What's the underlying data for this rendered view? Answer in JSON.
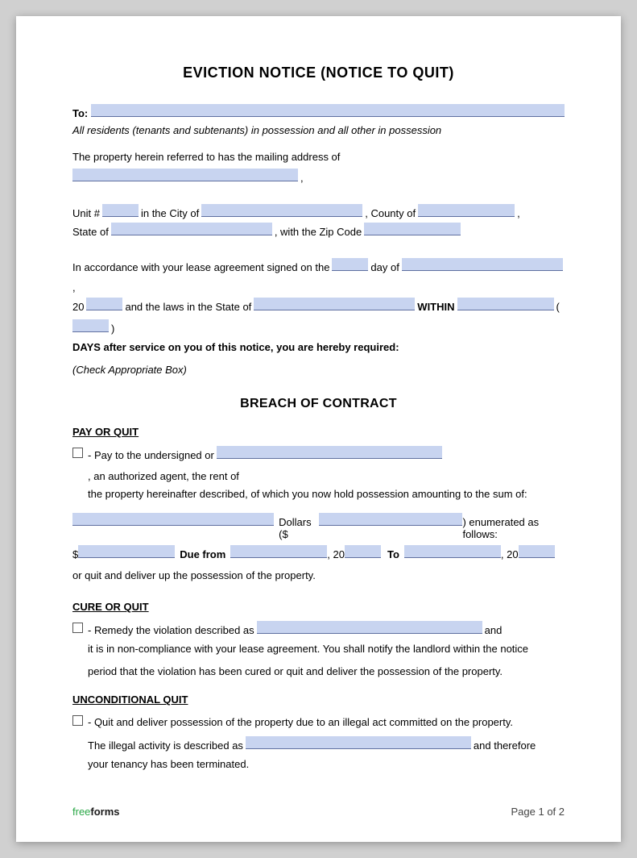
{
  "document": {
    "title": "EVICTION NOTICE (NOTICE TO QUIT)",
    "to_label": "To:",
    "italic_line": "All residents (tenants and subtenants) in possession and all other in possession",
    "address_intro": "The property herein referred to has the mailing address of",
    "unit_label": "Unit #",
    "city_label": "in the City of",
    "county_label": ", County of",
    "state_label": "State of",
    "zip_label": ", with the Zip Code",
    "lease_intro": "In accordance with your lease agreement signed on the",
    "day_label": "day of",
    "twenty_label": "20",
    "laws_label": "and the laws in the State of",
    "within_label": "WITHIN",
    "paren_open": "(",
    "paren_close": ")",
    "days_text": "DAYS after service on you of this notice, you are hereby required:",
    "check_label": "(Check Appropriate Box)",
    "breach_title": "BREACH OF CONTRACT",
    "pay_or_quit_title": "PAY OR QUIT",
    "pay_or_quit_text1": "- Pay to the undersigned or",
    "pay_or_quit_text2": ", an authorized agent, the rent of",
    "pay_or_quit_text3": "the property hereinafter described, of which you now hold possession amounting to the sum of:",
    "dollars_label": "Dollars ($",
    "dollars_close": ") enumerated as follows:",
    "due_dollar": "$",
    "due_from_label": "Due from",
    "due_twenty1": ", 20",
    "to_label2": "To",
    "due_twenty2": ", 20",
    "quit_deliver": "or quit and deliver up the possession of the property.",
    "cure_or_quit_title": "CURE OR QUIT",
    "cure_text1": "- Remedy the violation described as",
    "cure_text2": "and",
    "cure_text3": "it is in non-compliance with your lease agreement. You shall notify the landlord within the notice",
    "cure_text4": "period that the violation has been cured or quit and deliver the possession of the property.",
    "unconditional_quit_title": "UNCONDITIONAL QUIT",
    "unconditional_text": "- Quit and deliver possession of the property due to an illegal act committed on the property.",
    "illegal_text1": "The illegal activity is described as",
    "illegal_text2": "and therefore",
    "tenancy_text": "your tenancy has been terminated.",
    "footer_free": "free",
    "footer_forms": "forms",
    "footer_page": "Page 1 of 2"
  }
}
